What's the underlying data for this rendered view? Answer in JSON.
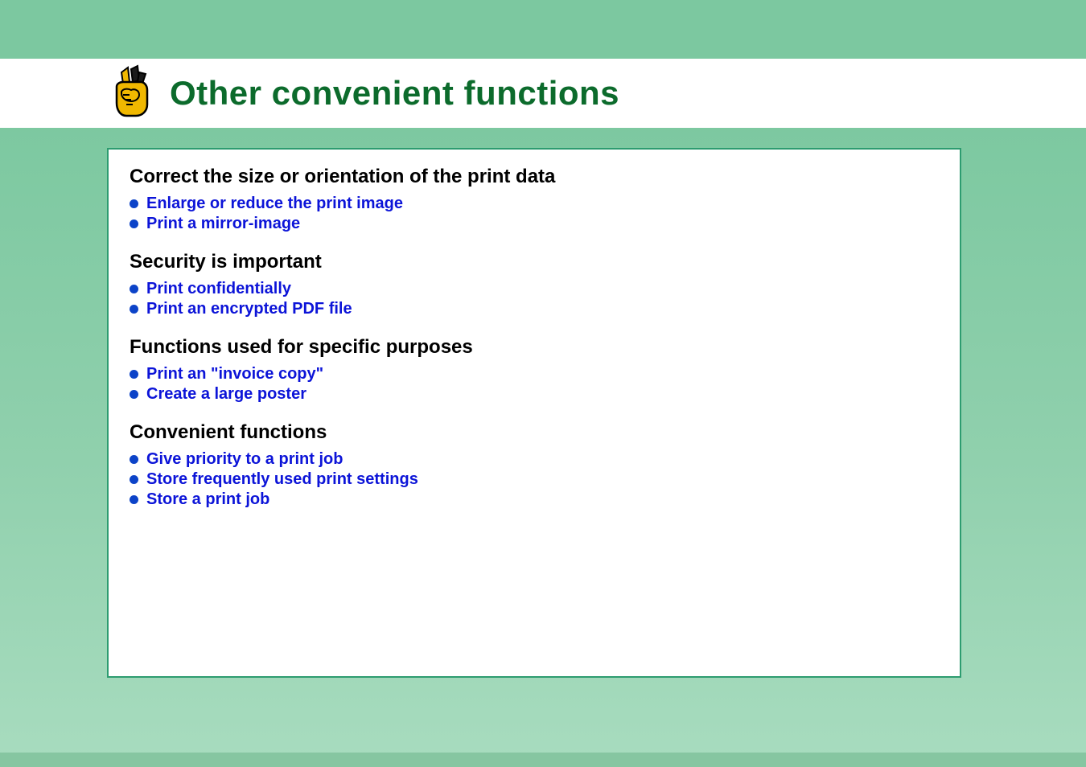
{
  "title": "Other convenient functions",
  "sections": [
    {
      "heading": "Correct the size or orientation of the print data",
      "links": [
        "Enlarge or reduce the print image",
        "Print a mirror-image"
      ]
    },
    {
      "heading": "Security is important",
      "links": [
        "Print confidentially",
        "Print an encrypted PDF file"
      ]
    },
    {
      "heading": "Functions used for specific purposes",
      "links": [
        "Print an \"invoice copy\"",
        "Create a large poster"
      ]
    },
    {
      "heading": "Convenient functions",
      "links": [
        "Give priority to a print job",
        "Store frequently used print settings",
        "Store a print job"
      ]
    }
  ]
}
